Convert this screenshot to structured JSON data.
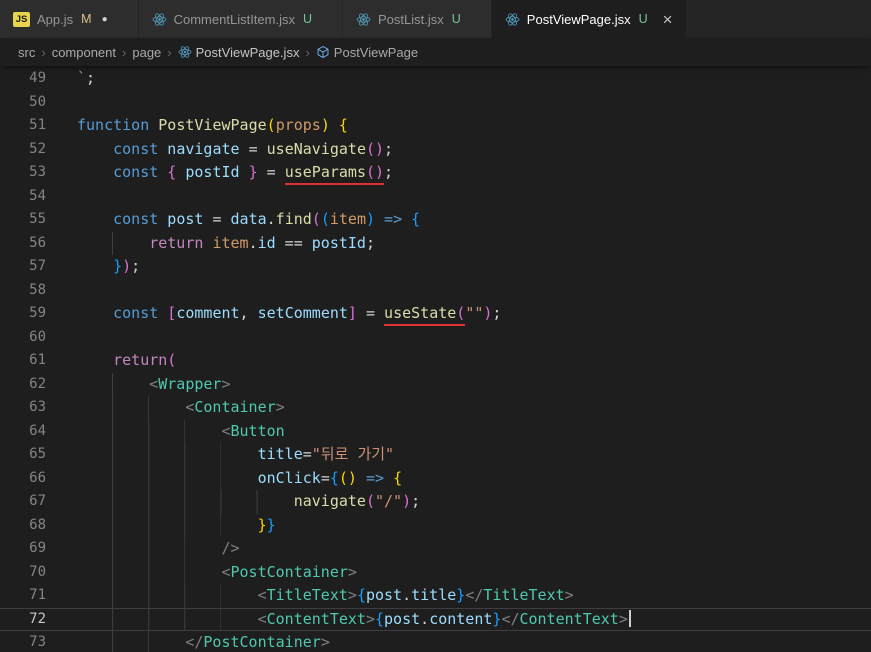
{
  "ui": {
    "breadcrumb_separator": "›"
  },
  "colors": {
    "error_underline": "#e03131",
    "react_icon": "#519aba",
    "symbol_icon": "#75beff",
    "git_modified": "#e2c08d",
    "git_untracked": "#73c991"
  },
  "tabs": [
    {
      "label": "App.js",
      "icon": "js",
      "git": "M",
      "dirty": true,
      "active": false
    },
    {
      "label": "CommentListItem.jsx",
      "icon": "react",
      "git": "U",
      "active": false
    },
    {
      "label": "PostList.jsx",
      "icon": "react",
      "git": "U",
      "active": false
    },
    {
      "label": "PostViewPage.jsx",
      "icon": "react",
      "git": "U",
      "active": true,
      "closable": true
    }
  ],
  "breadcrumb": [
    {
      "label": "src"
    },
    {
      "label": "component"
    },
    {
      "label": "page"
    },
    {
      "label": "PostViewPage.jsx",
      "icon": "react"
    },
    {
      "label": "PostViewPage",
      "icon": "symbol"
    }
  ],
  "editor": {
    "token_colors": {
      "kw": "#569cd6",
      "ctl": "#c586c0",
      "fn": "#dcdcaa",
      "vr": "#9cdcfe",
      "st": "#ce9178",
      "cmp": "#4ec9b0",
      "pl": "#d4d4d4",
      "ag": "#808080",
      "prm": "#d19a66",
      "b0": "#ffd700",
      "b1": "#da70d6",
      "b2": "#179fff"
    },
    "lines": [
      {
        "n": 49,
        "i": 0,
        "t": [
          [
            "st",
            "`"
          ],
          [
            "pl",
            ";"
          ]
        ]
      },
      {
        "n": 50,
        "i": 0,
        "t": []
      },
      {
        "n": 51,
        "i": 0,
        "t": [
          [
            "kw",
            "function"
          ],
          [
            "pl",
            " "
          ],
          [
            "fn",
            "PostViewPage"
          ],
          [
            "b0",
            "("
          ],
          [
            "prm",
            "props"
          ],
          [
            "b0",
            ")"
          ],
          [
            "pl",
            " "
          ],
          [
            "b0",
            "{"
          ]
        ]
      },
      {
        "n": 52,
        "i": 4,
        "t": [
          [
            "kw",
            "const"
          ],
          [
            "pl",
            " "
          ],
          [
            "vr",
            "navigate"
          ],
          [
            "pl",
            " = "
          ],
          [
            "fn",
            "useNavigate"
          ],
          [
            "b1",
            "("
          ],
          [
            "b1",
            ")"
          ],
          [
            "pl",
            ";"
          ]
        ]
      },
      {
        "n": 53,
        "i": 4,
        "t": [
          [
            "kw",
            "const"
          ],
          [
            "pl",
            " "
          ],
          [
            "b1",
            "{"
          ],
          [
            "pl",
            " "
          ],
          [
            "vr",
            "postId"
          ],
          [
            "pl",
            " "
          ],
          [
            "b1",
            "}"
          ],
          [
            "pl",
            " = "
          ],
          [
            "fn",
            "useParams",
            "u"
          ],
          [
            "b1",
            "(",
            "u"
          ],
          [
            "b1",
            ")",
            "u"
          ],
          [
            "pl",
            ";"
          ]
        ]
      },
      {
        "n": 54,
        "i": 0,
        "t": []
      },
      {
        "n": 55,
        "i": 4,
        "t": [
          [
            "kw",
            "const"
          ],
          [
            "pl",
            " "
          ],
          [
            "vr",
            "post"
          ],
          [
            "pl",
            " = "
          ],
          [
            "vr",
            "data"
          ],
          [
            "pl",
            "."
          ],
          [
            "fn",
            "find"
          ],
          [
            "b1",
            "("
          ],
          [
            "b2",
            "("
          ],
          [
            "prm",
            "item"
          ],
          [
            "b2",
            ")"
          ],
          [
            "pl",
            " "
          ],
          [
            "kw",
            "=>"
          ],
          [
            "pl",
            " "
          ],
          [
            "b2",
            "{"
          ]
        ]
      },
      {
        "n": 56,
        "i": 8,
        "t": [
          [
            "ctl",
            "return"
          ],
          [
            "pl",
            " "
          ],
          [
            "prm",
            "item"
          ],
          [
            "pl",
            "."
          ],
          [
            "vr",
            "id"
          ],
          [
            "pl",
            " == "
          ],
          [
            "vr",
            "postId"
          ],
          [
            "pl",
            ";"
          ]
        ]
      },
      {
        "n": 57,
        "i": 4,
        "t": [
          [
            "b2",
            "}"
          ],
          [
            "b1",
            ")"
          ],
          [
            "pl",
            ";"
          ]
        ]
      },
      {
        "n": 58,
        "i": 0,
        "t": []
      },
      {
        "n": 59,
        "i": 4,
        "t": [
          [
            "kw",
            "const"
          ],
          [
            "pl",
            " "
          ],
          [
            "b1",
            "["
          ],
          [
            "vr",
            "comment"
          ],
          [
            "pl",
            ", "
          ],
          [
            "vr",
            "setComment"
          ],
          [
            "b1",
            "]"
          ],
          [
            "pl",
            " = "
          ],
          [
            "fn",
            "useState",
            "u"
          ],
          [
            "b1",
            "(",
            "u"
          ],
          [
            "st",
            "\"\""
          ],
          [
            "b1",
            ")"
          ],
          [
            "pl",
            ";"
          ]
        ]
      },
      {
        "n": 60,
        "i": 0,
        "t": []
      },
      {
        "n": 61,
        "i": 4,
        "t": [
          [
            "ctl",
            "return"
          ],
          [
            "b1",
            "("
          ]
        ]
      },
      {
        "n": 62,
        "i": 8,
        "t": [
          [
            "ag",
            "<"
          ],
          [
            "cmp",
            "Wrapper"
          ],
          [
            "ag",
            ">"
          ]
        ]
      },
      {
        "n": 63,
        "i": 12,
        "t": [
          [
            "ag",
            "<"
          ],
          [
            "cmp",
            "Container"
          ],
          [
            "ag",
            ">"
          ]
        ]
      },
      {
        "n": 64,
        "i": 16,
        "t": [
          [
            "ag",
            "<"
          ],
          [
            "cmp",
            "Button"
          ]
        ]
      },
      {
        "n": 65,
        "i": 20,
        "t": [
          [
            "vr",
            "title"
          ],
          [
            "pl",
            "="
          ],
          [
            "st",
            "\"뒤로 가기\""
          ]
        ]
      },
      {
        "n": 66,
        "i": 20,
        "t": [
          [
            "vr",
            "onClick"
          ],
          [
            "pl",
            "="
          ],
          [
            "b2",
            "{"
          ],
          [
            "b0",
            "("
          ],
          [
            "b0",
            ")"
          ],
          [
            "pl",
            " "
          ],
          [
            "kw",
            "=>"
          ],
          [
            "pl",
            " "
          ],
          [
            "b0",
            "{"
          ]
        ]
      },
      {
        "n": 67,
        "i": 24,
        "t": [
          [
            "fn",
            "navigate"
          ],
          [
            "b1",
            "("
          ],
          [
            "st",
            "\"/\""
          ],
          [
            "b1",
            ")"
          ],
          [
            "pl",
            ";"
          ]
        ]
      },
      {
        "n": 68,
        "i": 20,
        "t": [
          [
            "b0",
            "}"
          ],
          [
            "b2",
            "}"
          ]
        ]
      },
      {
        "n": 69,
        "i": 16,
        "t": [
          [
            "ag",
            "/>"
          ]
        ]
      },
      {
        "n": 70,
        "i": 16,
        "t": [
          [
            "ag",
            "<"
          ],
          [
            "cmp",
            "PostContainer"
          ],
          [
            "ag",
            ">"
          ]
        ]
      },
      {
        "n": 71,
        "i": 20,
        "t": [
          [
            "ag",
            "<"
          ],
          [
            "cmp",
            "TitleText"
          ],
          [
            "ag",
            ">"
          ],
          [
            "b2",
            "{"
          ],
          [
            "vr",
            "post"
          ],
          [
            "pl",
            "."
          ],
          [
            "vr",
            "title"
          ],
          [
            "b2",
            "}"
          ],
          [
            "ag",
            "</"
          ],
          [
            "cmp",
            "TitleText"
          ],
          [
            "ag",
            ">"
          ]
        ]
      },
      {
        "n": 72,
        "i": 20,
        "cur": true,
        "cursor": true,
        "t": [
          [
            "ag",
            "<"
          ],
          [
            "cmp",
            "ContentText"
          ],
          [
            "ag",
            ">"
          ],
          [
            "b2",
            "{"
          ],
          [
            "vr",
            "post"
          ],
          [
            "pl",
            "."
          ],
          [
            "vr",
            "content"
          ],
          [
            "b2",
            "}"
          ],
          [
            "ag",
            "</"
          ],
          [
            "cmp",
            "ContentText"
          ],
          [
            "ag",
            ">"
          ]
        ]
      },
      {
        "n": 73,
        "i": 12,
        "t": [
          [
            "ag",
            "</"
          ],
          [
            "cmp",
            "PostContainer"
          ],
          [
            "ag",
            ">"
          ]
        ]
      }
    ]
  }
}
